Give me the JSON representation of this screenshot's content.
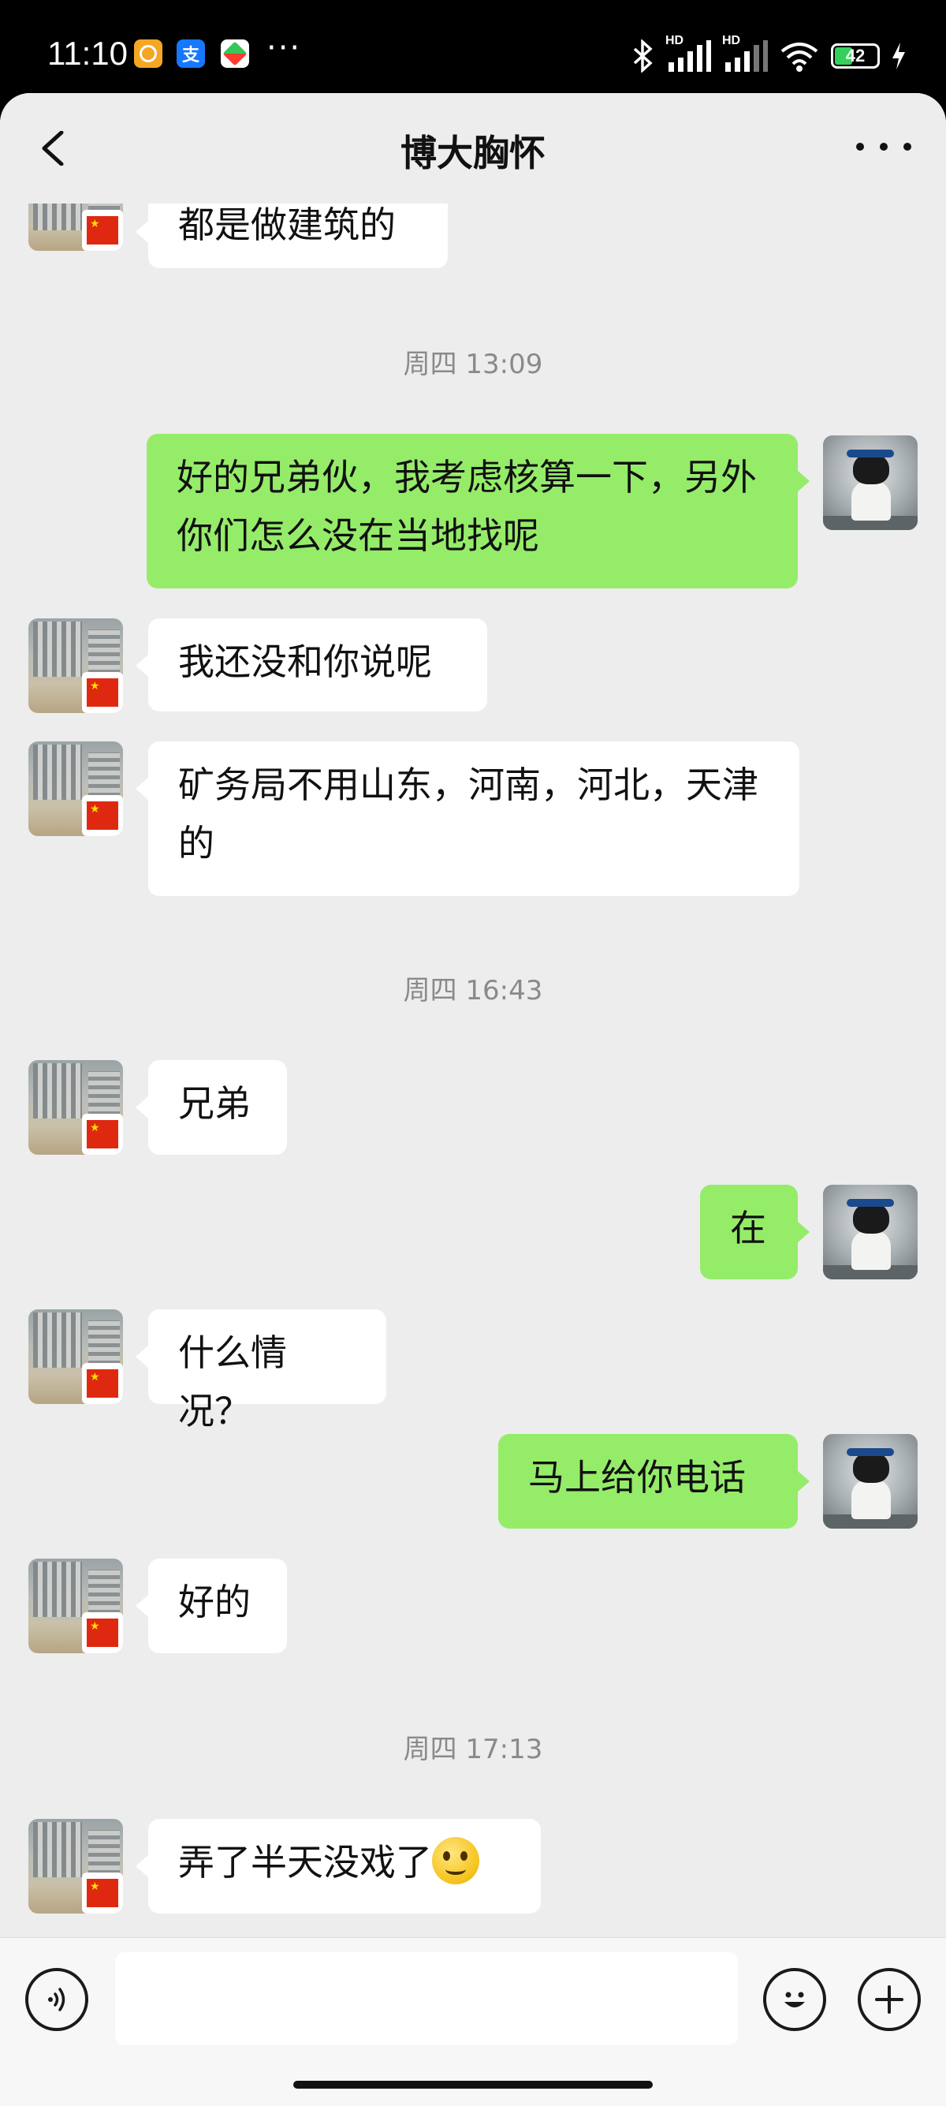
{
  "status_bar": {
    "time": "11:10",
    "app_icons": [
      "photos-app-icon",
      "alipay-app-icon",
      "games-app-icon"
    ],
    "alipay_glyph": "支",
    "more_notifications": "···",
    "battery_level": 42,
    "battery_text": "42",
    "signal_labels": [
      "HD",
      "HD"
    ]
  },
  "nav": {
    "title": "博大胸怀"
  },
  "messages": [
    {
      "side": "in",
      "text": "都是做建筑的"
    },
    {
      "type": "timestamp",
      "text": "周四 13:09"
    },
    {
      "side": "out",
      "text": "好的兄弟伙，我考虑核算一下，另外你们怎么没在当地找呢"
    },
    {
      "side": "in",
      "text": "我还没和你说呢"
    },
    {
      "side": "in",
      "text": "矿务局不用山东，河南，河北，天津的"
    },
    {
      "type": "timestamp",
      "text": "周四 16:43"
    },
    {
      "side": "in",
      "text": "兄弟"
    },
    {
      "side": "out",
      "text": "在"
    },
    {
      "side": "in",
      "text": "什么情况？"
    },
    {
      "side": "out",
      "text": "马上给你电话"
    },
    {
      "side": "in",
      "text": "好的"
    },
    {
      "type": "timestamp",
      "text": "周四 17:13"
    },
    {
      "side": "in",
      "text": "弄了半天没戏了",
      "emoji": "smile-emoji"
    }
  ],
  "colors": {
    "outgoing_bubble": "#95ec69",
    "incoming_bubble": "#ffffff",
    "chat_background": "#ededed"
  },
  "input_bar": {
    "placeholder": ""
  }
}
